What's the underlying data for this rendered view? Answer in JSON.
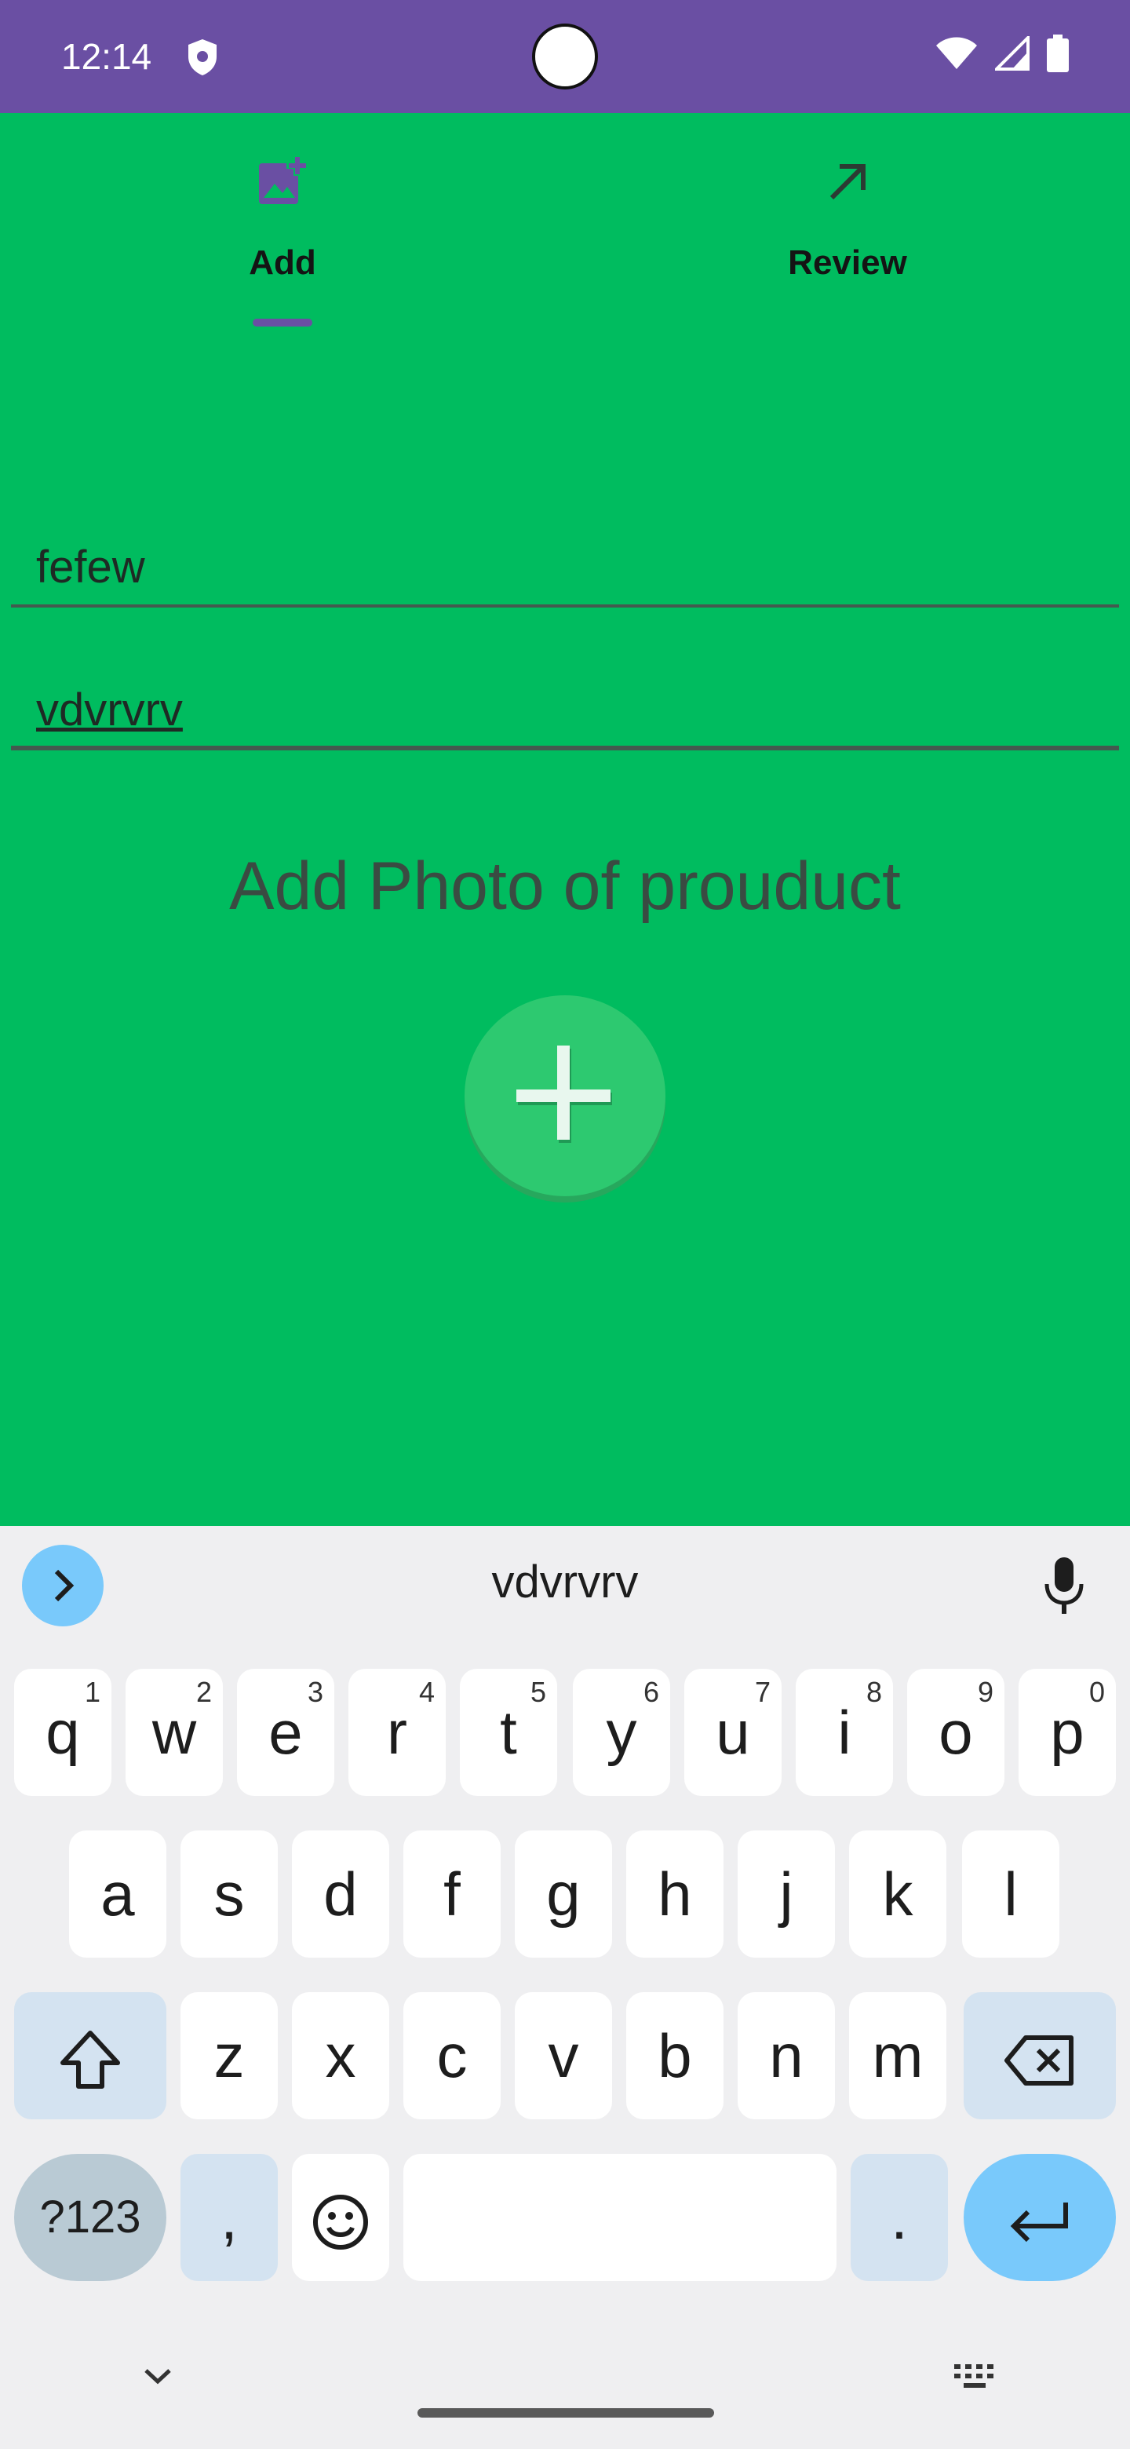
{
  "status_bar": {
    "time": "12:14",
    "background": "#6a4fa3",
    "icons": [
      "shield-icon",
      "wifi-icon",
      "signal-icon",
      "battery-icon"
    ]
  },
  "tabs": [
    {
      "label": "Add",
      "icon": "add-photo-icon",
      "selected": true
    },
    {
      "label": "Review",
      "icon": "arrow-up-right-icon",
      "selected": false
    }
  ],
  "form": {
    "field1_value": "fefew",
    "field2_value": "vdvrvrv"
  },
  "photo": {
    "title": "Add Photo of prouduct",
    "button_icon": "plus-icon"
  },
  "colors": {
    "app_background": "#00bc5f",
    "accent": "#6a4fa3",
    "fab": "#2dc970"
  },
  "keyboard": {
    "suggestion": "vdvrvrv",
    "row1": [
      {
        "key": "q",
        "hint": "1"
      },
      {
        "key": "w",
        "hint": "2"
      },
      {
        "key": "e",
        "hint": "3"
      },
      {
        "key": "r",
        "hint": "4"
      },
      {
        "key": "t",
        "hint": "5"
      },
      {
        "key": "y",
        "hint": "6"
      },
      {
        "key": "u",
        "hint": "7"
      },
      {
        "key": "i",
        "hint": "8"
      },
      {
        "key": "o",
        "hint": "9"
      },
      {
        "key": "p",
        "hint": "0"
      }
    ],
    "row2": [
      "a",
      "s",
      "d",
      "f",
      "g",
      "h",
      "j",
      "k",
      "l"
    ],
    "row3": [
      "z",
      "x",
      "c",
      "v",
      "b",
      "n",
      "m"
    ],
    "symbols_label": "?123",
    "comma": ",",
    "period": "."
  }
}
